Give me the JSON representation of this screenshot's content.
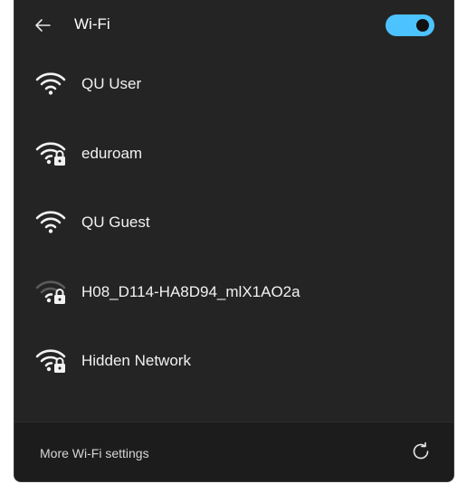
{
  "header": {
    "title": "Wi-Fi",
    "back_icon": "arrow-left-icon",
    "toggle_on": true
  },
  "networks": [
    {
      "name": "QU User",
      "icon": "wifi-signal-full-icon",
      "secured": false
    },
    {
      "name": "eduroam",
      "icon": "wifi-secured-icon",
      "secured": true
    },
    {
      "name": "QU Guest",
      "icon": "wifi-signal-full-icon",
      "secured": false
    },
    {
      "name": "H08_D114-HA8D94_mlX1AO2a",
      "icon": "wifi-secured-weak-icon",
      "secured": true
    },
    {
      "name": "Hidden Network",
      "icon": "wifi-secured-icon",
      "secured": true
    }
  ],
  "footer": {
    "link_label": "More Wi-Fi settings",
    "refresh_icon": "refresh-icon"
  },
  "colors": {
    "accent": "#4cc2ff",
    "panel_bg": "#242424",
    "footer_bg": "#1c1c1c",
    "text": "#f2f2f2"
  }
}
